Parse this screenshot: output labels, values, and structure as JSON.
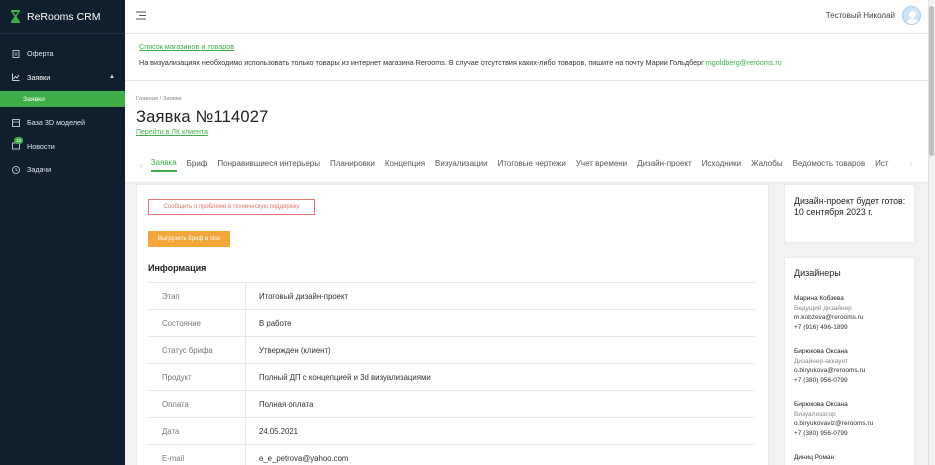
{
  "brand": {
    "name": "ReRooms CRM",
    "accent": "#3fae49"
  },
  "sidebar": {
    "items": [
      {
        "label": "Оферта",
        "icon": "document-icon"
      },
      {
        "label": "Заявки",
        "icon": "chart-icon"
      },
      {
        "label": "База 3D моделей",
        "icon": "cube-icon"
      },
      {
        "label": "Новости",
        "icon": "news-icon",
        "badge": "15"
      },
      {
        "label": "Задачи",
        "icon": "clock-icon"
      }
    ],
    "subitem": "Заявки"
  },
  "topbar": {
    "user_name": "Тестовый Николай"
  },
  "notice": {
    "link": "Список магазинов и товаров",
    "text": "На визуализациях необходимо использовать только товары из интернет магазина Rerooms. В случае отсутствия каких-либо товаров, пишите на почту Марии Гольдберг",
    "email": "mgoldberg@rerooms.ru"
  },
  "header": {
    "breadcrumb": "Главная / Заявки",
    "title": "Заявка №114027",
    "client_link": "Перейти в ЛК клиента",
    "tabs": [
      "Заявка",
      "Бриф",
      "Понравившиеся интерьеры",
      "Планировки",
      "Концепция",
      "Визуализации",
      "Итоговые чертежи",
      "Учет времени",
      "Дизайн-проект",
      "Исходники",
      "Жалобы",
      "Ведомость товаров",
      "Ист"
    ]
  },
  "main": {
    "problem_button": "Сообщить о проблеме в техническую поддержку",
    "export_button": "Выгрузить бриф в xlsx",
    "section_title": "Информация",
    "rows": [
      {
        "label": "Этап",
        "value": "Итоговый дизайн-проект"
      },
      {
        "label": "Состояние",
        "value": "В работе"
      },
      {
        "label": "Статус брифа",
        "value": "Утвержден (клиент)"
      },
      {
        "label": "Продукт",
        "value": "Полный ДП с концепцией и 3d визуализациями"
      },
      {
        "label": "Оплата",
        "value": "Полная оплата"
      },
      {
        "label": "Дата",
        "value": "24.05.2021"
      },
      {
        "label": "E-mail",
        "value": "e_e_petrova@yahoo.com"
      }
    ]
  },
  "deadline": {
    "text": "Дизайн-проект будет готов: 10 сентября 2023 г."
  },
  "designers": {
    "title": "Дизайнеры",
    "list": [
      {
        "name": "Марина Кобзева",
        "role": "Ведущий дизайнер",
        "email": "m.kobzeva@rerooms.ru",
        "phone": "+7 (916) 496-1899"
      },
      {
        "name": "Бирюкова Оксана",
        "role": "Дизайнер-аккаунт",
        "email": "o.biryukova@rerooms.ru",
        "phone": "+7 (380) 956-0799"
      },
      {
        "name": "Бирюкова Оксана",
        "role": "Визуализатор",
        "email": "o.biryukovaviz@rerooms.ru",
        "phone": "+7 (380) 956-0799"
      },
      {
        "name": "Диниц Роман",
        "role": "",
        "email": "",
        "phone": ""
      }
    ]
  }
}
